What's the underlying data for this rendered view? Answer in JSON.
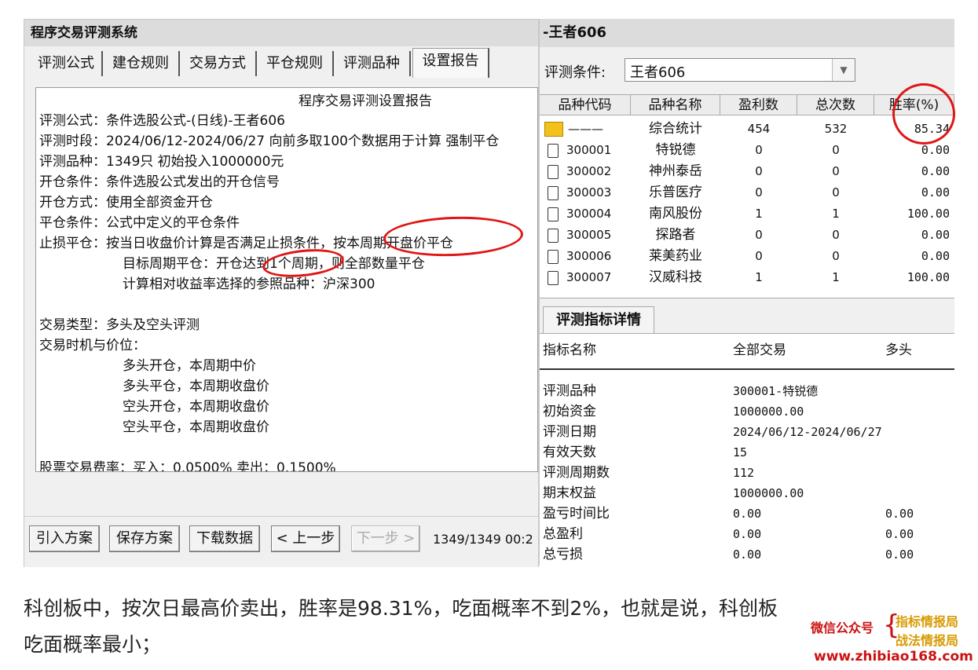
{
  "left": {
    "title": "程序交易评测系统",
    "tabs": [
      "评测公式",
      "建仓规则",
      "交易方式",
      "平仓规则",
      "评测品种",
      "设置报告"
    ],
    "report_title": "程序交易评测设置报告",
    "report_lines": [
      "评测公式：条件选股公式-(日线)-王者606",
      "评测时段：2024/06/12-2024/06/27 向前多取100个数据用于计算 强制平仓",
      "评测品种：1349只 初始投入1000000元",
      "开仓条件：条件选股公式发出的开仓信号",
      "开仓方式：使用全部资金开仓",
      "平仓条件：公式中定义的平仓条件",
      "止损平仓：按当日收盘价计算是否满足止损条件，按本周期开盘价平仓",
      "目标周期平仓：开仓达到1个周期，则全部数量平仓",
      "计算相对收益率选择的参照品种：沪深300",
      "交易类型：多头及空头评测",
      "交易时机与价位：",
      "多头开仓，本周期中价",
      "多头平仓，本周期收盘价",
      "空头开仓，本周期收盘价",
      "空头平仓，本周期收盘价",
      "股票交易费率：买入：0.0500% 卖出：0.1500%"
    ],
    "buttons": {
      "import": "引入方案",
      "save": "保存方案",
      "download": "下载数据",
      "prev": "< 上一步",
      "next": "下一步 >"
    },
    "progress_text": "1349/1349 00:2"
  },
  "right": {
    "title": "-王者606",
    "condition_label": "评测条件:",
    "condition_value": "王者606",
    "columns": [
      "品种代码",
      "品种名称",
      "盈利数",
      "总次数",
      "胜率(%)"
    ],
    "summary": {
      "code": "———",
      "name": "综合统计",
      "profit": "454",
      "total": "532",
      "rate": "85.34"
    },
    "rows": [
      {
        "code": "300001",
        "name": "特锐德",
        "profit": "0",
        "total": "0",
        "rate": "0.00"
      },
      {
        "code": "300002",
        "name": "神州泰岳",
        "profit": "0",
        "total": "0",
        "rate": "0.00"
      },
      {
        "code": "300003",
        "name": "乐普医疗",
        "profit": "0",
        "total": "0",
        "rate": "0.00"
      },
      {
        "code": "300004",
        "name": "南风股份",
        "profit": "1",
        "total": "1",
        "rate": "100.00"
      },
      {
        "code": "300005",
        "name": "探路者",
        "profit": "0",
        "total": "0",
        "rate": "0.00"
      },
      {
        "code": "300006",
        "name": "莱美药业",
        "profit": "0",
        "total": "0",
        "rate": "0.00"
      },
      {
        "code": "300007",
        "name": "汉威科技",
        "profit": "1",
        "total": "1",
        "rate": "100.00"
      }
    ],
    "detail_tab": "评测指标详情",
    "detail_header": [
      "指标名称",
      "全部交易",
      "多头"
    ],
    "detail_rows": [
      {
        "name": "评测品种",
        "all": "300001-特锐德",
        "long": ""
      },
      {
        "name": "初始资金",
        "all": "1000000.00",
        "long": ""
      },
      {
        "name": "评测日期",
        "all": "2024/06/12-2024/06/27",
        "long": ""
      },
      {
        "name": "有效天数",
        "all": "15",
        "long": ""
      },
      {
        "name": "评测周期数",
        "all": "112",
        "long": ""
      },
      {
        "name": "期末权益",
        "all": "1000000.00",
        "long": ""
      },
      {
        "name": "盈亏时间比",
        "all": "0.00",
        "long": "0.00"
      },
      {
        "name": "总盈利",
        "all": "0.00",
        "long": "0.00"
      },
      {
        "name": "总亏损",
        "all": "0.00",
        "long": "0.00"
      }
    ]
  },
  "caption": {
    "line1": "科创板中，按次日最高价卖出，胜率是98.31%，吃面概率不到2%，也就是说，科创板",
    "line2": "吃面概率最小；"
  },
  "watermark": {
    "label": "微信公众号",
    "name1": "指标情报局",
    "name2": "战法情报局",
    "url": "www.zhibiao168.com"
  },
  "colors": {
    "annotation": "#e01515",
    "watermark_red": "#cc1111",
    "watermark_gold": "#d89a00"
  }
}
